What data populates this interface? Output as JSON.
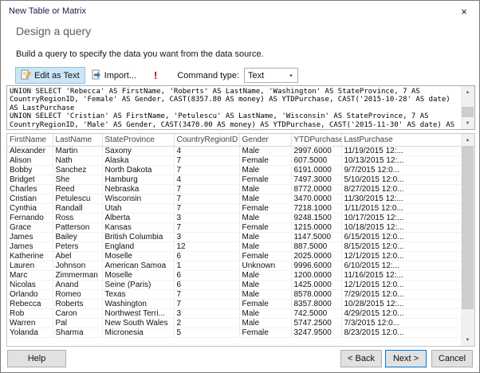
{
  "window": {
    "title": "New Table or Matrix",
    "close_glyph": "×"
  },
  "header": {
    "title": "Design a query",
    "subtitle": "Build a query to specify the data you want from the data source."
  },
  "toolbar": {
    "edit_as_text": "Edit as Text",
    "import": "Import...",
    "run_icon": "!",
    "command_type_label": "Command type:",
    "command_type_value": "Text"
  },
  "icons": {
    "chevron_down": "▾",
    "scroll_up": "▲",
    "scroll_down": "▼"
  },
  "query": {
    "lines": [
      "UNION SELECT 'Rebecca' AS FirstName, 'Roberts' AS LastName, 'Washington' AS StateProvince, 7 AS",
      "CountryRegionID, 'Female' AS Gender, CAST(8357.80 AS money) AS YTDPurchase, CAST('2015-10-28' AS date)",
      "AS LastPurchase",
      "UNION SELECT 'Cristian' AS FirstName, 'Petulescu' AS LastName, 'Wisconsin' AS StateProvince, 7 AS",
      "CountryRegionID, 'Male' AS Gender, CAST(3470.00 AS money) AS YTDPurchase, CAST('2015-11-30' AS date) AS"
    ]
  },
  "results": {
    "columns": [
      "FirstName",
      "LastName",
      "StateProvince",
      "CountryRegionID",
      "Gender",
      "YTDPurchase",
      "LastPurchase"
    ],
    "rows": [
      [
        "Alexander",
        "Martin",
        "Saxony",
        "4",
        "Male",
        "2997.6000",
        "11/19/2015 12:..."
      ],
      [
        "Alison",
        "Nath",
        "Alaska",
        "7",
        "Female",
        "607.5000",
        "10/13/2015 12:..."
      ],
      [
        "Bobby",
        "Sanchez",
        "North Dakota",
        "7",
        "Male",
        "6191.0000",
        "9/7/2015 12:0..."
      ],
      [
        "Bridget",
        "She",
        "Hamburg",
        "4",
        "Female",
        "7497.3000",
        "5/10/2015 12:0..."
      ],
      [
        "Charles",
        "Reed",
        "Nebraska",
        "7",
        "Male",
        "8772.0000",
        "8/27/2015 12:0..."
      ],
      [
        "Cristian",
        "Petulescu",
        "Wisconsin",
        "7",
        "Male",
        "3470.0000",
        "11/30/2015 12:..."
      ],
      [
        "Cynthia",
        "Randall",
        "Utah",
        "7",
        "Female",
        "7218.1000",
        "1/11/2015 12:0..."
      ],
      [
        "Fernando",
        "Ross",
        "Alberta",
        "3",
        "Male",
        "9248.1500",
        "10/17/2015 12:..."
      ],
      [
        "Grace",
        "Patterson",
        "Kansas",
        "7",
        "Female",
        "1215.0000",
        "10/18/2015 12:..."
      ],
      [
        "James",
        "Bailey",
        "British Columbia",
        "3",
        "Male",
        "1147.5000",
        "6/15/2015 12:0..."
      ],
      [
        "James",
        "Peters",
        "England",
        "12",
        "Male",
        "887.5000",
        "8/15/2015 12:0..."
      ],
      [
        "Katherine",
        "Abel",
        "Moselle",
        "6",
        "Female",
        "2025.0000",
        "12/1/2015 12:0..."
      ],
      [
        "Lauren",
        "Johnson",
        "American Samoa",
        "1",
        "Unknown",
        "9996.6000",
        "6/10/2015 12:..."
      ],
      [
        "Marc",
        "Zimmerman",
        "Moselle",
        "6",
        "Male",
        "1200.0000",
        "11/16/2015 12:..."
      ],
      [
        "Nicolas",
        "Anand",
        "Seine (Paris)",
        "6",
        "Male",
        "1425.0000",
        "12/1/2015 12:0..."
      ],
      [
        "Orlando",
        "Romeo",
        "Texas",
        "7",
        "Male",
        "8578.0000",
        "7/29/2015 12:0..."
      ],
      [
        "Rebecca",
        "Roberts",
        "Washington",
        "7",
        "Female",
        "8357.8000",
        "10/28/2015 12:..."
      ],
      [
        "Rob",
        "Caron",
        "Northwest Terri...",
        "3",
        "Male",
        "742.5000",
        "4/29/2015 12:0..."
      ],
      [
        "Warren",
        "Pal",
        "New South Wales",
        "2",
        "Male",
        "5747.2500",
        "7/3/2015 12:0..."
      ],
      [
        "Yolanda",
        "Sharma",
        "Micronesia",
        "5",
        "Female",
        "3247.9500",
        "8/23/2015 12:0..."
      ]
    ]
  },
  "footer": {
    "help": "Help",
    "back": "< Back",
    "next": "Next >",
    "cancel": "Cancel"
  },
  "colors": {
    "accent": "#0078d7",
    "run_red": "#c00000",
    "toggle_bg": "#cde6f7",
    "toggle_border": "#92c0e0"
  }
}
